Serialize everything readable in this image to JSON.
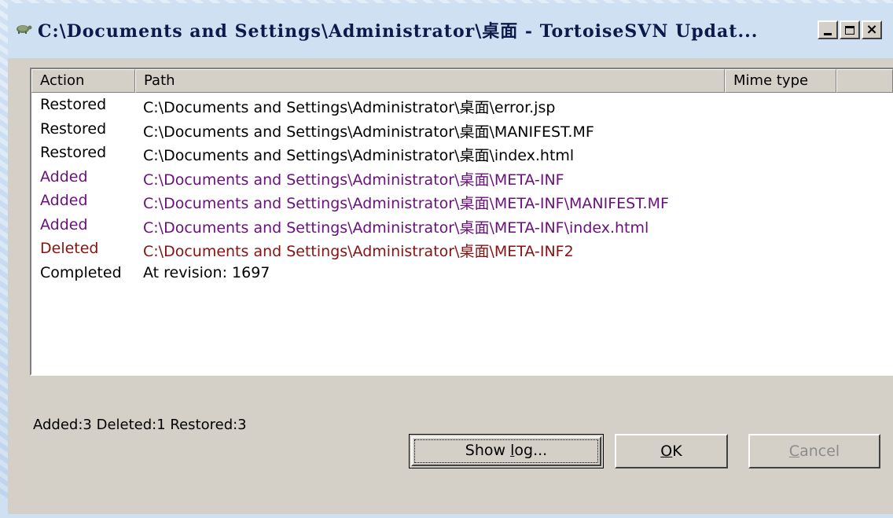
{
  "window": {
    "title": "C:\\Documents and Settings\\Administrator\\桌面 - TortoiseSVN Updat..."
  },
  "columns": {
    "action": "Action",
    "path": "Path",
    "mime": "Mime type"
  },
  "rows": [
    {
      "action": "Restored",
      "path": "C:\\Documents and Settings\\Administrator\\桌面\\error.jsp",
      "color": "#000000"
    },
    {
      "action": "Restored",
      "path": "C:\\Documents and Settings\\Administrator\\桌面\\MANIFEST.MF",
      "color": "#000000"
    },
    {
      "action": "Restored",
      "path": "C:\\Documents and Settings\\Administrator\\桌面\\index.html",
      "color": "#000000"
    },
    {
      "action": "Added",
      "path": "C:\\Documents and Settings\\Administrator\\桌面\\META-INF",
      "color": "#6b0f7e"
    },
    {
      "action": "Added",
      "path": "C:\\Documents and Settings\\Administrator\\桌面\\META-INF\\MANIFEST.MF",
      "color": "#6b0f7e"
    },
    {
      "action": "Added",
      "path": "C:\\Documents and Settings\\Administrator\\桌面\\META-INF\\index.html",
      "color": "#6b0f7e"
    },
    {
      "action": "Deleted",
      "path": "C:\\Documents and Settings\\Administrator\\桌面\\META-INF2",
      "color": "#8b1010"
    },
    {
      "action": "Completed",
      "path": "At revision: 1697",
      "color": "#000000"
    }
  ],
  "summary": "Added:3 Deleted:1 Restored:3",
  "buttons": {
    "show_log_pre": "Show ",
    "show_log_u": "l",
    "show_log_post": "og...",
    "ok_u": "O",
    "ok_post": "K",
    "cancel_u": "C",
    "cancel_post": "ancel"
  },
  "colors": {
    "added": "#6b0f7e",
    "deleted": "#8b1010",
    "normal": "#000000",
    "disabled": "#8c8c8c"
  }
}
